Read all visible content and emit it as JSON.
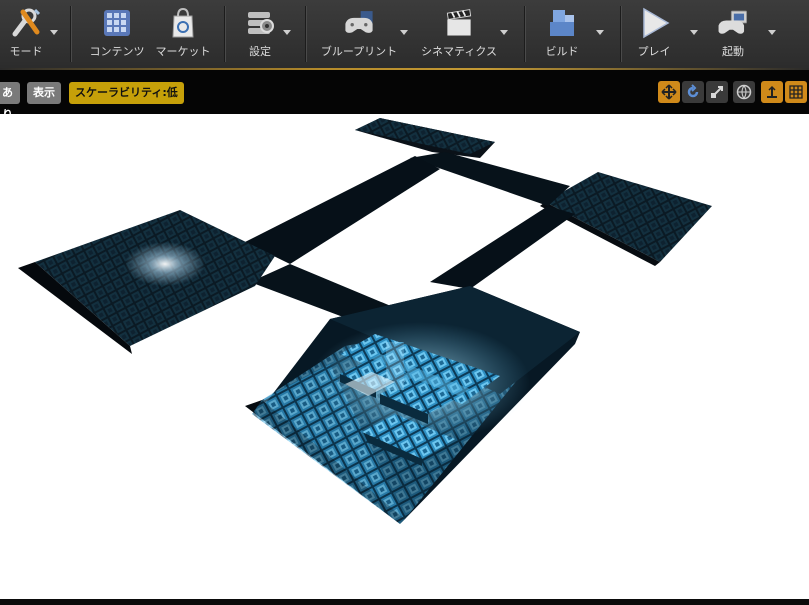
{
  "toolbar": {
    "buttons": [
      {
        "label": "モード"
      },
      {
        "label": "コンテンツ"
      },
      {
        "label": "マーケット"
      },
      {
        "label": "設定"
      },
      {
        "label": "ブループリント"
      },
      {
        "label": "シネマティクス"
      },
      {
        "label": "ビルド"
      },
      {
        "label": "プレイ"
      },
      {
        "label": "起動"
      }
    ]
  },
  "viewport_bar": {
    "lit_label": "あり",
    "show_label": "表示",
    "scalability_label": "スケーラビリティ:低"
  },
  "colors": {
    "accent": "#c49a35",
    "gold_button": "#c6a009",
    "orange_button": "#d08a1a",
    "tile_glow": "#4fb7e6"
  }
}
